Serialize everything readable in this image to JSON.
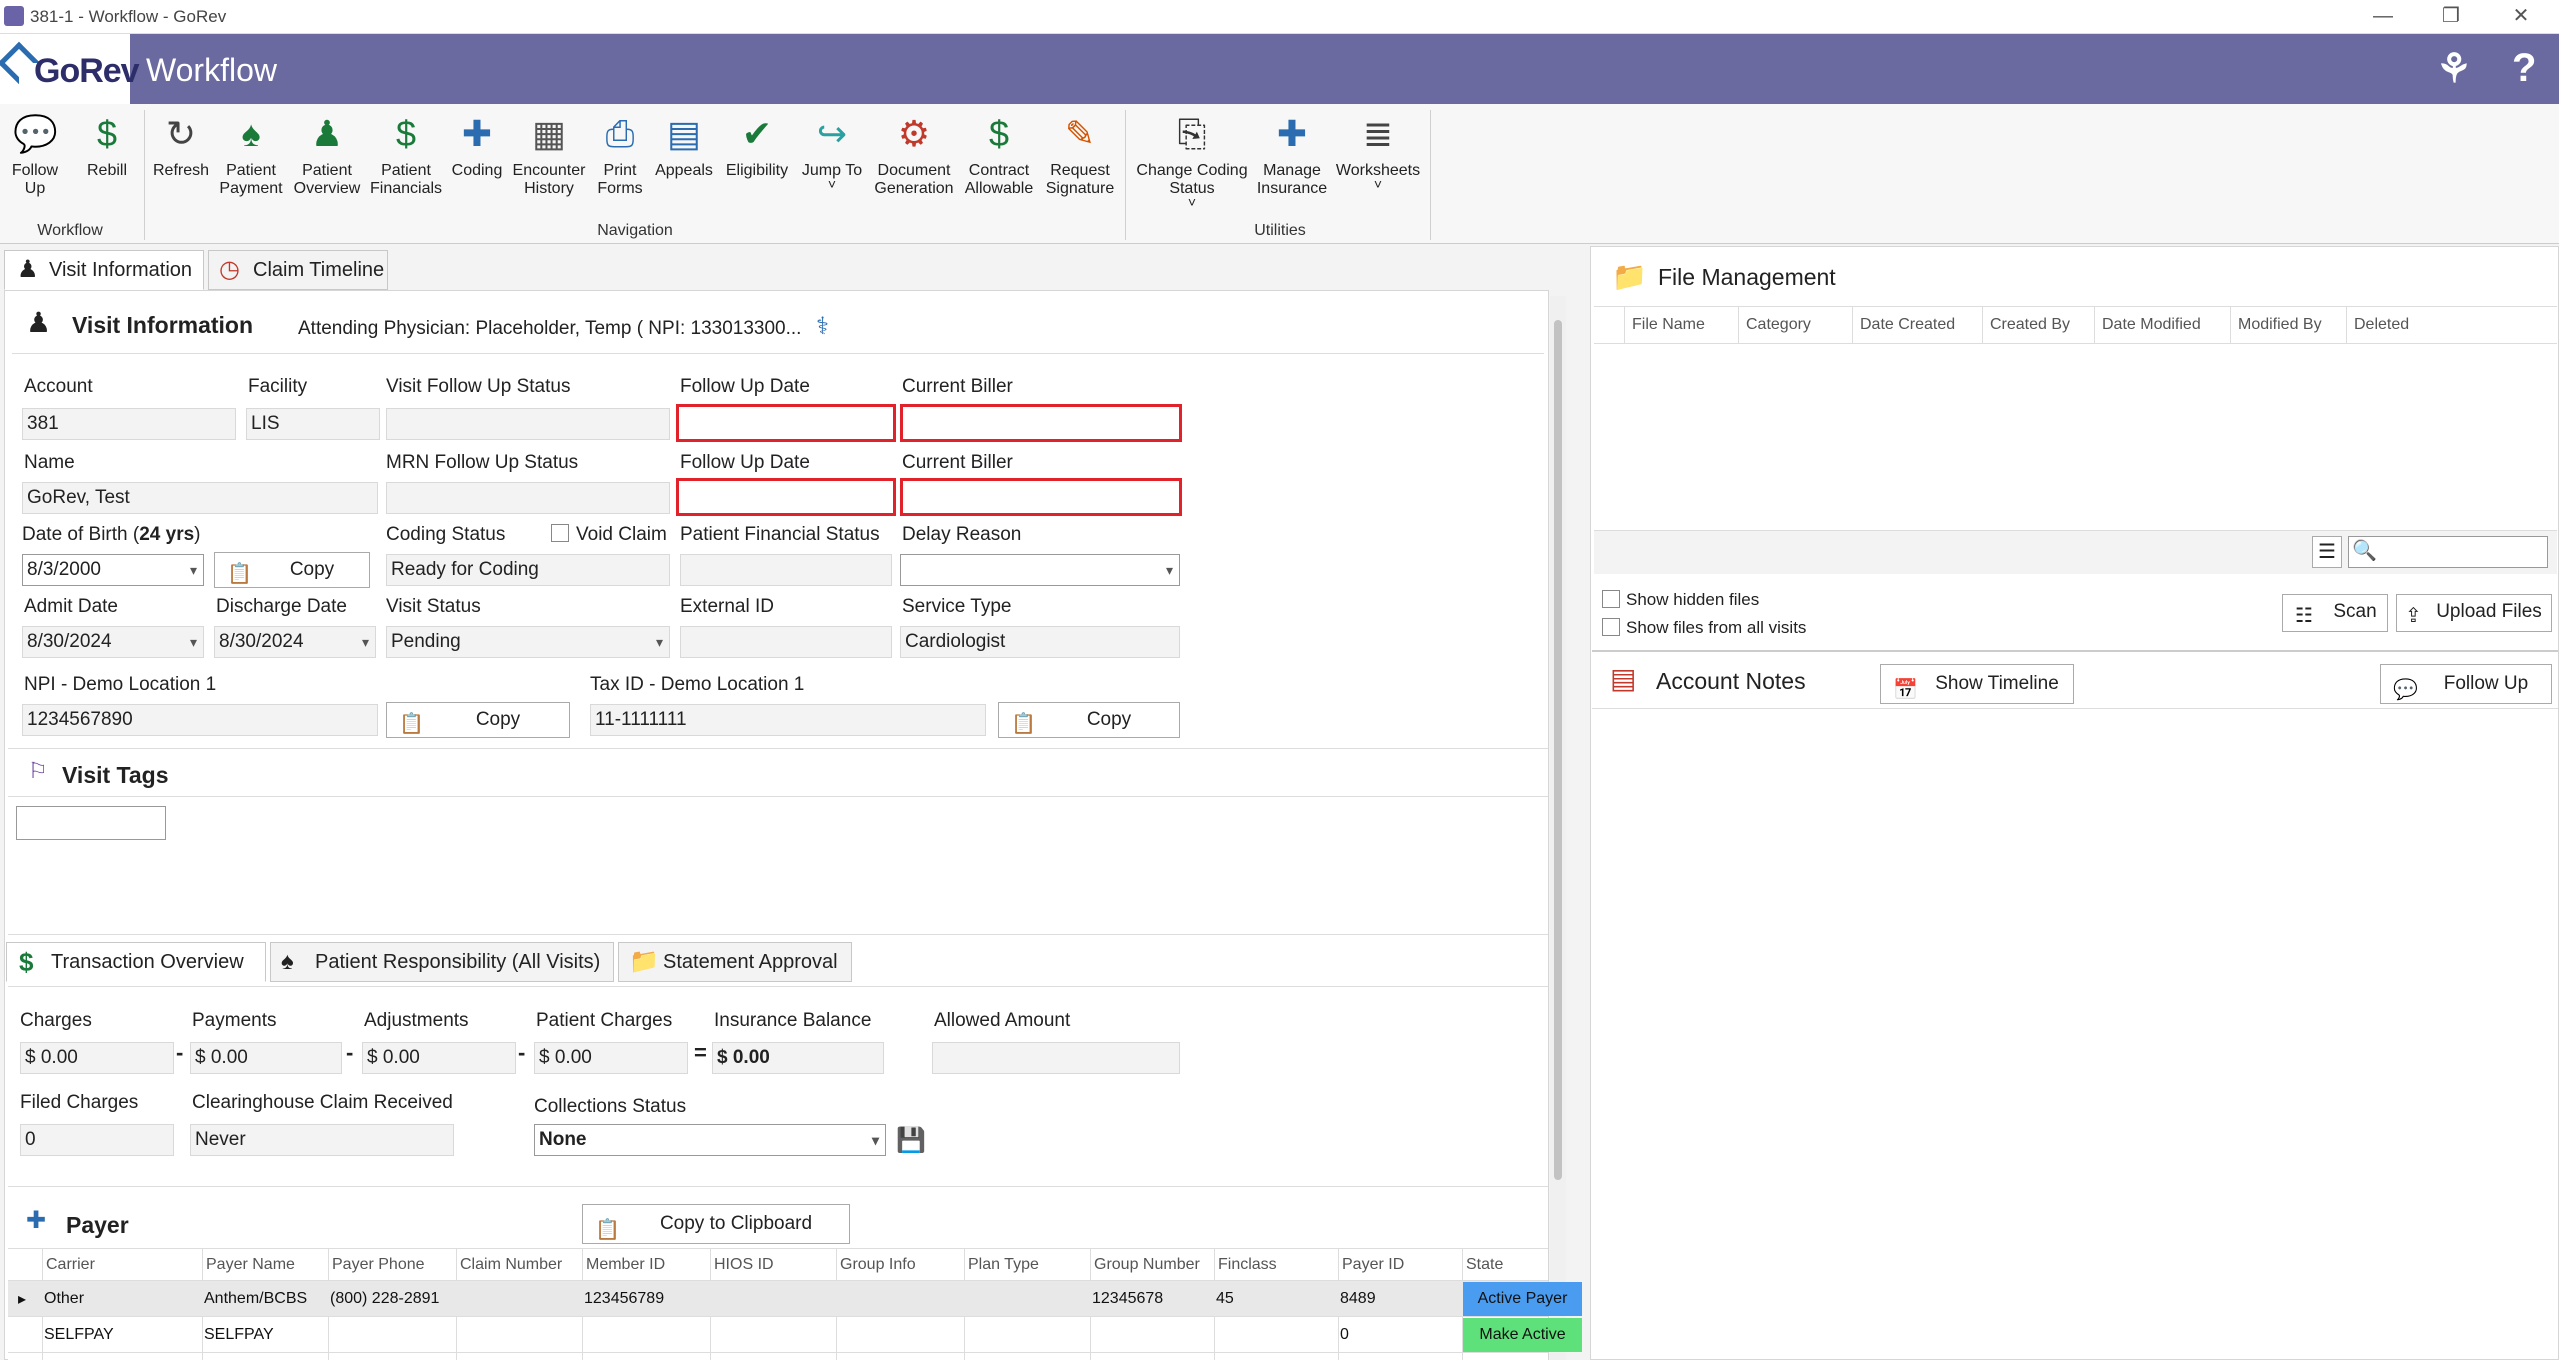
{
  "window": {
    "title": "381-1 - Workflow - GoRev",
    "minimize": "—",
    "restore": "❐",
    "close": "✕"
  },
  "header": {
    "logo_text": "GoRev",
    "title": "Workflow",
    "help": "?",
    "keys_icon": "⚘"
  },
  "ribbon": {
    "buttons": [
      {
        "label": "Follow\nUp",
        "icon": "chat-icon",
        "glyph": "💬"
      },
      {
        "label": "Rebill",
        "icon": "rebill-icon",
        "glyph": "$"
      },
      {
        "label": "Refresh",
        "icon": "refresh-icon",
        "glyph": "↻"
      },
      {
        "label": "Patient\nPayment",
        "icon": "payment-icon",
        "glyph": "♠"
      },
      {
        "label": "Patient\nOverview",
        "icon": "patient-icon",
        "glyph": "♟"
      },
      {
        "label": "Patient\nFinancials",
        "icon": "dollar-icon",
        "glyph": "$"
      },
      {
        "label": "Coding",
        "icon": "book-icon",
        "glyph": "✚"
      },
      {
        "label": "Encounter\nHistory",
        "icon": "calendar-icon",
        "glyph": "▦"
      },
      {
        "label": "Print\nForms",
        "icon": "printer-icon",
        "glyph": "⎙"
      },
      {
        "label": "Appeals",
        "icon": "documents-icon",
        "glyph": "▤"
      },
      {
        "label": "Eligibility",
        "icon": "eligibility-icon",
        "glyph": "✔"
      },
      {
        "label": "Jump To",
        "icon": "jump-icon",
        "glyph": "↪",
        "dropdown": "˅"
      },
      {
        "label": "Document\nGeneration",
        "icon": "robot-icon",
        "glyph": "⚙"
      },
      {
        "label": "Contract\nAllowable",
        "icon": "contract-icon",
        "glyph": "$"
      },
      {
        "label": "Request\nSignature",
        "icon": "signature-icon",
        "glyph": "✎"
      },
      {
        "label": "Change Coding\nStatus",
        "icon": "file-status-icon",
        "glyph": "⎘",
        "dropdown": "˅"
      },
      {
        "label": "Manage\nInsurance",
        "icon": "insurance-icon",
        "glyph": "✚"
      },
      {
        "label": "Worksheets",
        "icon": "worksheets-icon",
        "glyph": "≣",
        "dropdown": "˅"
      }
    ],
    "groups": [
      "Workflow",
      "Navigation",
      "Utilities"
    ]
  },
  "tabs": {
    "visit_information": "Visit Information",
    "claim_timeline": "Claim Timeline"
  },
  "visit": {
    "section_title": "Visit Information",
    "attending": "Attending Physician: Placeholder, Temp ( NPI: 133013300...",
    "account_label": "Account",
    "account": "381",
    "facility_label": "Facility",
    "facility": "LIS",
    "visit_follow_up_status_label": "Visit Follow Up Status",
    "visit_follow_up_status": "",
    "follow_up_date_label": "Follow Up Date",
    "follow_up_date": "",
    "current_biller_label": "Current Biller",
    "current_biller": "",
    "name_label": "Name",
    "name": "GoRev, Test",
    "mrn_follow_up_status_label": "MRN Follow Up Status",
    "mrn_follow_up_status": "",
    "follow_up_date2_label": "Follow Up Date",
    "follow_up_date2": "",
    "current_biller2_label": "Current Biller",
    "current_biller2": "",
    "dob_label": "Date of Birth (",
    "dob_age": "24 yrs",
    "dob_close": ")",
    "dob": "8/3/2000",
    "copy": "Copy",
    "coding_status_label": "Coding Status",
    "void_claim": "Void Claim",
    "coding_status": "Ready for Coding",
    "patient_financial_status_label": "Patient Financial Status",
    "patient_financial_status": "",
    "delay_reason_label": "Delay Reason",
    "delay_reason": "",
    "admit_date_label": "Admit Date",
    "admit_date": "8/30/2024",
    "discharge_date_label": "Discharge Date",
    "discharge_date": "8/30/2024",
    "visit_status_label": "Visit Status",
    "visit_status": "Pending",
    "external_id_label": "External ID",
    "external_id": "",
    "service_type_label": "Service Type",
    "service_type": "Cardiologist",
    "npi_label": "NPI - Demo Location 1",
    "npi": "1234567890",
    "tax_id_label": "Tax ID - Demo Location 1",
    "tax_id": "11-1111111"
  },
  "visit_tags": {
    "title": "Visit Tags",
    "value": ""
  },
  "transaction_tabs": {
    "overview": "Transaction Overview",
    "responsibility": "Patient Responsibility (All Visits)",
    "statement": "Statement Approval"
  },
  "transactions": {
    "charges_label": "Charges",
    "charges": "$ 0.00",
    "payments_label": "Payments",
    "payments": "$ 0.00",
    "adjustments_label": "Adjustments",
    "adjustments": "$ 0.00",
    "patient_charges_label": "Patient Charges",
    "patient_charges": "$ 0.00",
    "insurance_balance_label": "Insurance Balance",
    "insurance_balance": "$ 0.00",
    "allowed_amount_label": "Allowed Amount",
    "allowed_amount": "",
    "minus": "-",
    "equals": "=",
    "filed_charges_label": "Filed Charges",
    "filed_charges": "0",
    "clearinghouse_label": "Clearinghouse Claim Received",
    "clearinghouse": "Never",
    "collections_label": "Collections Status",
    "collections": "None"
  },
  "payer": {
    "title": "Payer",
    "copy_button": "Copy to Clipboard",
    "columns": [
      "Carrier",
      "Payer Name",
      "Payer Phone",
      "Claim Number",
      "Member ID",
      "HIOS ID",
      "Group Info",
      "Plan Type",
      "Group Number",
      "Finclass",
      "Payer ID",
      "State"
    ],
    "rows": [
      [
        "Other",
        "Anthem/BCBS",
        "(800) 228-2891",
        "",
        "123456789",
        "",
        "",
        "",
        "12345678",
        "45",
        "8489",
        "Active Payer"
      ],
      [
        "SELFPAY",
        "SELFPAY",
        "",
        "",
        "",
        "",
        "",
        "",
        "",
        "",
        "0",
        "Make Active"
      ]
    ],
    "row_marker": "▸"
  },
  "file_management": {
    "title": "File Management",
    "columns": [
      "File Name",
      "Category",
      "Date Created",
      "Created By",
      "Date Modified",
      "Modified By",
      "Deleted"
    ],
    "show_hidden": "Show hidden files",
    "show_all_visits": "Show files from all visits",
    "scan": "Scan",
    "upload": "Upload Files",
    "search_value": ""
  },
  "account_notes": {
    "title": "Account Notes",
    "show_timeline": "Show Timeline",
    "follow_up": "Follow Up"
  },
  "colors": {
    "header": "#6a69a0",
    "active_payer": "#4a9cf0",
    "make_active": "#5ee07a",
    "highlight": "#e2222a"
  }
}
